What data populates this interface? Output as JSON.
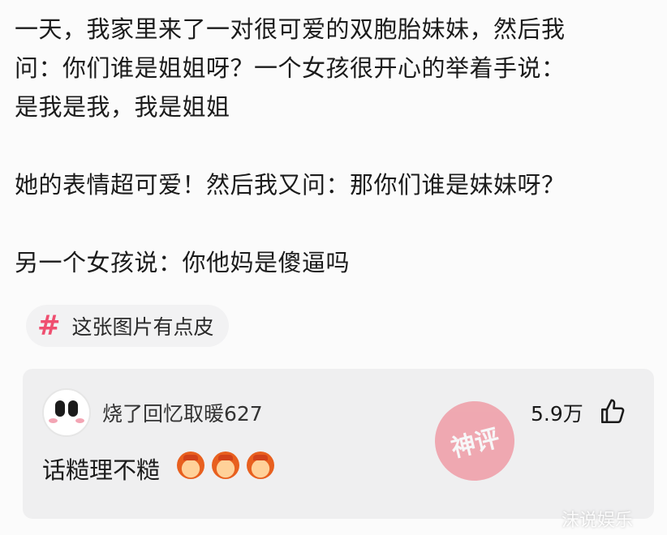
{
  "post": {
    "line1": "一天，我家里来了一对很可爱的双胞胎妹妹，然后我",
    "line2": "问：你们谁是姐姐呀？一个女孩很开心的举着手说：",
    "line3": "是我是我，我是姐姐",
    "line4": "她的表情超可爱！然后我又问：那你们谁是妹妹呀？",
    "line5": "另一个女孩说：你他妈是傻逼吗"
  },
  "topic": {
    "icon": "hashtag-icon",
    "label": "这张图片有点皮"
  },
  "comment": {
    "username": "烧了回忆取暖627",
    "likes": "5.9万",
    "like_icon": "thumbs-up-icon",
    "text": "话糙理不糙",
    "emoji_icon": "hard-hat-face-icon",
    "stamp_text": "神评"
  },
  "watermark": "沫说娱乐",
  "colors": {
    "accent": "#ef4f70",
    "background": "#fbfbfb",
    "comment_bg": "#efeff0"
  }
}
